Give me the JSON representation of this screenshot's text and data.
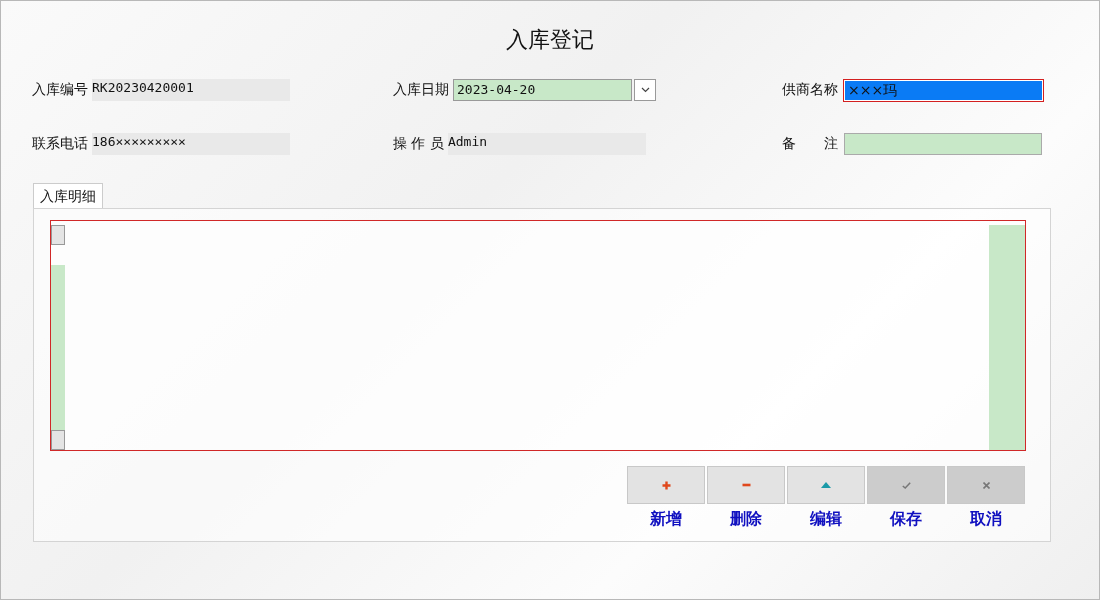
{
  "title": "入库登记",
  "fields": [
    {
      "label": "入库编号",
      "value": "RK20230420001",
      "kind": "readonly"
    },
    {
      "label": "入库日期",
      "value": "2023-04-20",
      "kind": "date"
    },
    {
      "label": "供商名称",
      "value": "×××玛",
      "kind": "focused"
    },
    {
      "label": "联系电话",
      "value": "186×××××××××",
      "kind": "readonly"
    },
    {
      "label": "操 作 员",
      "value": "Admin",
      "kind": "readonly"
    },
    {
      "label": "备　　注",
      "kind": "input"
    }
  ],
  "tabs": [
    {
      "label": "入库明细",
      "selected": true
    }
  ],
  "buttons": [
    {
      "label": "新增",
      "kind": "add",
      "disabled": false
    },
    {
      "label": "删除",
      "kind": "delete",
      "disabled": false
    },
    {
      "label": "编辑",
      "kind": "edit",
      "disabled": false
    },
    {
      "label": "保存",
      "kind": "save",
      "disabled": true
    },
    {
      "label": "取消",
      "kind": "cancel",
      "disabled": true
    }
  ]
}
